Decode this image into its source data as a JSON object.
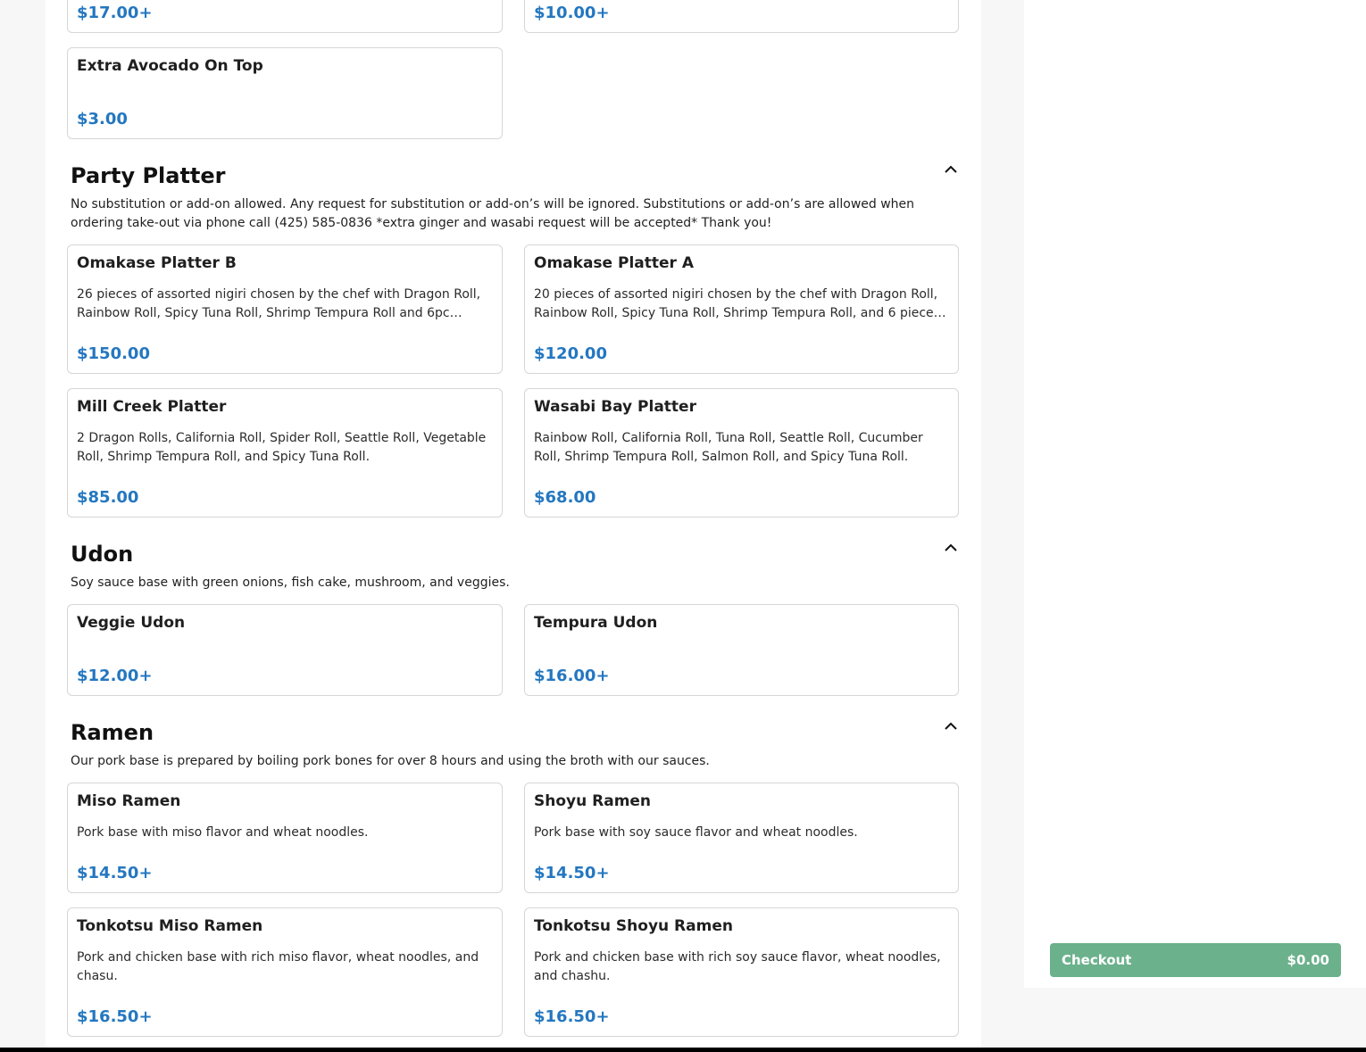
{
  "top_cards": {
    "left_price": "$17.00+",
    "right_price": "$10.00+",
    "extra_avocado": {
      "name": "Extra Avocado On Top",
      "price": "$3.00"
    }
  },
  "party_platter": {
    "title": "Party Platter",
    "description": "No substitution or add-on allowed. Any request for substitution or add-on’s will be ignored. Substitutions or add-on’s are allowed when ordering take-out via phone call (425) 585-0836 *extra ginger and wasabi request will be accepted* Thank you!",
    "items": [
      {
        "name": "Omakase Platter B",
        "description": "26 pieces of assorted nigiri chosen by the chef with Dragon Roll, Rainbow Roll, Spicy Tuna Roll, Shrimp Tempura Roll and 6pc…",
        "price": "$150.00"
      },
      {
        "name": "Omakase Platter A",
        "description": "20 pieces of assorted nigiri chosen by the chef with Dragon Roll, Rainbow Roll, Spicy Tuna Roll, Shrimp Tempura Roll, and 6 piece…",
        "price": "$120.00"
      },
      {
        "name": "Mill Creek Platter",
        "description": "2 Dragon Rolls, California Roll, Spider Roll, Seattle Roll, Vegetable Roll, Shrimp Tempura Roll, and Spicy Tuna Roll.",
        "price": "$85.00"
      },
      {
        "name": "Wasabi Bay Platter",
        "description": "Rainbow Roll, California Roll, Tuna Roll, Seattle Roll, Cucumber Roll, Shrimp Tempura Roll, Salmon Roll, and Spicy Tuna Roll.",
        "price": "$68.00"
      }
    ]
  },
  "udon": {
    "title": "Udon",
    "description": "Soy sauce base with green onions, fish cake, mushroom, and veggies.",
    "items": [
      {
        "name": "Veggie Udon",
        "price": "$12.00+"
      },
      {
        "name": "Tempura Udon",
        "price": "$16.00+"
      }
    ]
  },
  "ramen": {
    "title": "Ramen",
    "description": "Our pork base is prepared by boiling pork bones for over 8 hours and using the broth with our sauces.",
    "items": [
      {
        "name": "Miso Ramen",
        "description": "Pork base with miso flavor and wheat noodles.",
        "price": "$14.50+"
      },
      {
        "name": "Shoyu Ramen",
        "description": "Pork base with soy sauce flavor and wheat noodles.",
        "price": "$14.50+"
      },
      {
        "name": "Tonkotsu Miso Ramen",
        "description": "Pork and chicken base with rich miso flavor, wheat noodles, and chasu.",
        "price": "$16.50+"
      },
      {
        "name": "Tonkotsu Shoyu Ramen",
        "description": "Pork and chicken base with rich soy sauce flavor, wheat noodles, and chashu.",
        "price": "$16.50+"
      }
    ]
  },
  "checkout": {
    "label": "Checkout",
    "amount": "$0.00"
  },
  "icons": {
    "collapse": "chevron-up-icon"
  },
  "colors": {
    "price": "#2477c0",
    "checkout": "#6bb18c"
  }
}
